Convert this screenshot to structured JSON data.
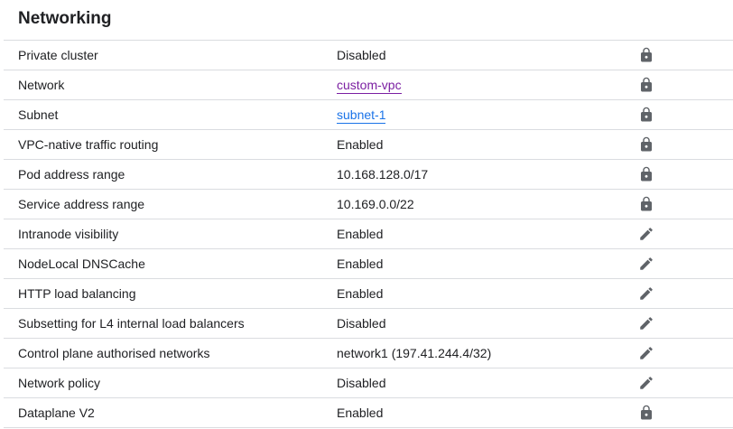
{
  "section": {
    "title": "Networking"
  },
  "rows": [
    {
      "label": "Private cluster",
      "value": "Disabled",
      "icon": "lock-icon"
    },
    {
      "label": "Network",
      "value": "custom-vpc",
      "icon": "lock-icon",
      "link": true,
      "link_color": "#7b1fa2"
    },
    {
      "label": "Subnet",
      "value": "subnet-1",
      "icon": "lock-icon",
      "link": true,
      "link_color": "#1a73e8"
    },
    {
      "label": "VPC-native traffic routing",
      "value": "Enabled",
      "icon": "lock-icon"
    },
    {
      "label": "Pod address range",
      "value": "10.168.128.0/17",
      "icon": "lock-icon"
    },
    {
      "label": "Service address range",
      "value": "10.169.0.0/22",
      "icon": "lock-icon"
    },
    {
      "label": "Intranode visibility",
      "value": "Enabled",
      "icon": "edit-icon"
    },
    {
      "label": "NodeLocal DNSCache",
      "value": "Enabled",
      "icon": "edit-icon"
    },
    {
      "label": "HTTP load balancing",
      "value": "Enabled",
      "icon": "edit-icon"
    },
    {
      "label": "Subsetting for L4 internal load balancers",
      "value": "Disabled",
      "icon": "edit-icon"
    },
    {
      "label": "Control plane authorised networks",
      "value": "network1 (197.41.244.4/32)",
      "icon": "edit-icon"
    },
    {
      "label": "Network policy",
      "value": "Disabled",
      "icon": "edit-icon"
    },
    {
      "label": "Dataplane V2",
      "value": "Enabled",
      "icon": "lock-icon"
    }
  ],
  "colors": {
    "text": "#202124",
    "divider": "#dadce0",
    "icon": "#5f6368"
  }
}
